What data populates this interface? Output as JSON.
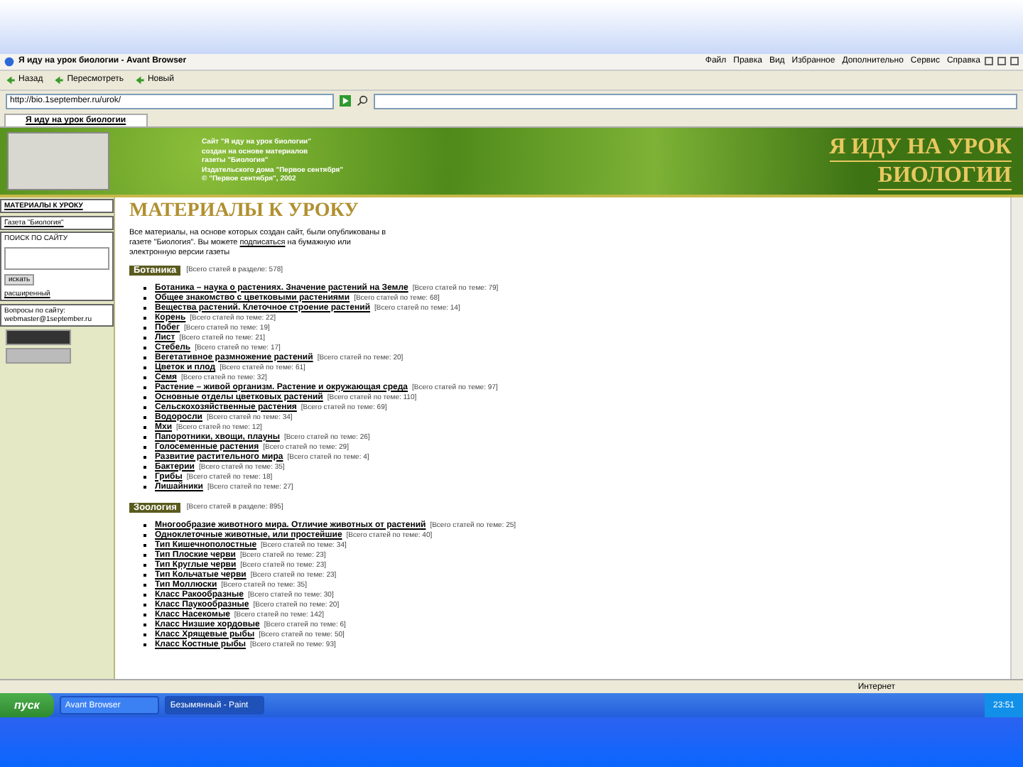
{
  "browser": {
    "title": "Я иду на урок биологии - Avant Browser",
    "menu": [
      "Файл",
      "Правка",
      "Вид",
      "Избранное",
      "Дополнительно",
      "Сервис",
      "Справка"
    ],
    "toolbar": [
      {
        "label": "Назад"
      },
      {
        "label": "Пересмотреть"
      },
      {
        "label": "Новый"
      }
    ],
    "address": "http://bio.1september.ru/urok/",
    "tabs": [
      {
        "label": "Я иду на урок биологии",
        "selected": true
      }
    ]
  },
  "header": {
    "lines": [
      "Сайт \"Я иду на урок биологии\"",
      "создан на основе материалов",
      "газеты \"Биология\"",
      "Издательского дома \"Первое сентября\"",
      "© \"Первое сентября\", 2002"
    ],
    "title_lines": [
      "Я ИДУ НА УРОК",
      "БИОЛОГИИ"
    ]
  },
  "sidebar": {
    "items": [
      {
        "label": "МАТЕРИАЛЫ К УРОКУ",
        "selected": true
      },
      {
        "label": "Газета \"Биология\"",
        "selected": false
      }
    ],
    "search_label": "ПОИСК ПО САЙТУ",
    "search_button": "искать",
    "advanced_link": "расширенный",
    "contact": "Вопросы по сайту:",
    "email": "webmaster@1september.ru"
  },
  "page": {
    "heading": "МАТЕРИАЛЫ К УРОКУ",
    "intro": {
      "before": "Все материалы, на основе которых создан сайт, были опубликованы в газете \"Биология\". Вы можете ",
      "link": "подписаться",
      "after": " на бумажную или электронную версии газеты"
    },
    "sections": [
      {
        "name": "Ботаника",
        "count": "[Всего статей в разделе: 578]",
        "topics": [
          {
            "title": "Ботаника – наука о растениях. Значение растений на Земле",
            "count": "[Всего статей по теме: 79]"
          },
          {
            "title": "Общее знакомство с цветковыми растениями",
            "count": "[Всего статей по теме: 68]"
          },
          {
            "title": "Вещества растений. Клеточное строение растений",
            "count": "[Всего статей по теме: 14]"
          },
          {
            "title": "Корень",
            "count": "[Всего статей по теме: 22]"
          },
          {
            "title": "Побег",
            "count": "[Всего статей по теме: 19]"
          },
          {
            "title": "Лист",
            "count": "[Всего статей по теме: 21]"
          },
          {
            "title": "Стебель",
            "count": "[Всего статей по теме: 17]"
          },
          {
            "title": "Вегетативное размножение растений",
            "count": "[Всего статей по теме: 20]"
          },
          {
            "title": "Цветок и плод",
            "count": "[Всего статей по теме: 61]"
          },
          {
            "title": "Семя",
            "count": "[Всего статей по теме: 32]"
          },
          {
            "title": "Растение – живой организм. Растение и окружающая среда",
            "count": "[Всего статей по теме: 97]"
          },
          {
            "title": "Основные отделы цветковых растений",
            "count": "[Всего статей по теме: 110]"
          },
          {
            "title": "Сельскохозяйственные растения",
            "count": "[Всего статей по теме: 69]"
          },
          {
            "title": "Водоросли",
            "count": "[Всего статей по теме: 34]"
          },
          {
            "title": "Мхи",
            "count": "[Всего статей по теме: 12]"
          },
          {
            "title": "Папоротники, хвощи, плауны",
            "count": "[Всего статей по теме: 26]"
          },
          {
            "title": "Голосеменные растения",
            "count": "[Всего статей по теме: 29]"
          },
          {
            "title": "Развитие растительного мира",
            "count": "[Всего статей по теме: 4]"
          },
          {
            "title": "Бактерии",
            "count": "[Всего статей по теме: 35]"
          },
          {
            "title": "Грибы",
            "count": "[Всего статей по теме: 18]"
          },
          {
            "title": "Лишайники",
            "count": "[Всего статей по теме: 27]"
          }
        ]
      },
      {
        "name": "Зоология",
        "count": "[Всего статей в разделе: 895]",
        "topics": [
          {
            "title": "Многообразие животного мира. Отличие животных от растений",
            "count": "[Всего статей по теме: 25]"
          },
          {
            "title": "Одноклеточные животные, или простейшие",
            "count": "[Всего статей по теме: 40]"
          },
          {
            "title": "Тип Кишечнополостные",
            "count": "[Всего статей по теме: 34]"
          },
          {
            "title": "Тип Плоские черви",
            "count": "[Всего статей по теме: 23]"
          },
          {
            "title": "Тип Круглые черви",
            "count": "[Всего статей по теме: 23]"
          },
          {
            "title": "Тип Кольчатые черви",
            "count": "[Всего статей по теме: 23]"
          },
          {
            "title": "Тип Моллюски",
            "count": "[Всего статей по теме: 35]"
          },
          {
            "title": "Класс Ракообразные",
            "count": "[Всего статей по теме: 30]"
          },
          {
            "title": "Класс Паукообразные",
            "count": "[Всего статей по теме: 20]"
          },
          {
            "title": "Класс Насекомые",
            "count": "[Всего статей по теме: 142]"
          },
          {
            "title": "Класс Низшие хордовые",
            "count": "[Всего статей по теме: 6]"
          },
          {
            "title": "Класс Хрящевые рыбы",
            "count": "[Всего статей по теме: 50]"
          },
          {
            "title": "Класс Костные рыбы",
            "count": "[Всего статей по теме: 93]"
          }
        ]
      }
    ]
  },
  "status_bar": {
    "zone": "Интернет"
  },
  "taskbar": {
    "start": "пуск",
    "items": [
      {
        "label": "Avant Browser",
        "selected": false
      },
      {
        "label": "Безымянный - Paint",
        "selected": true
      }
    ],
    "clock": "23:51"
  }
}
